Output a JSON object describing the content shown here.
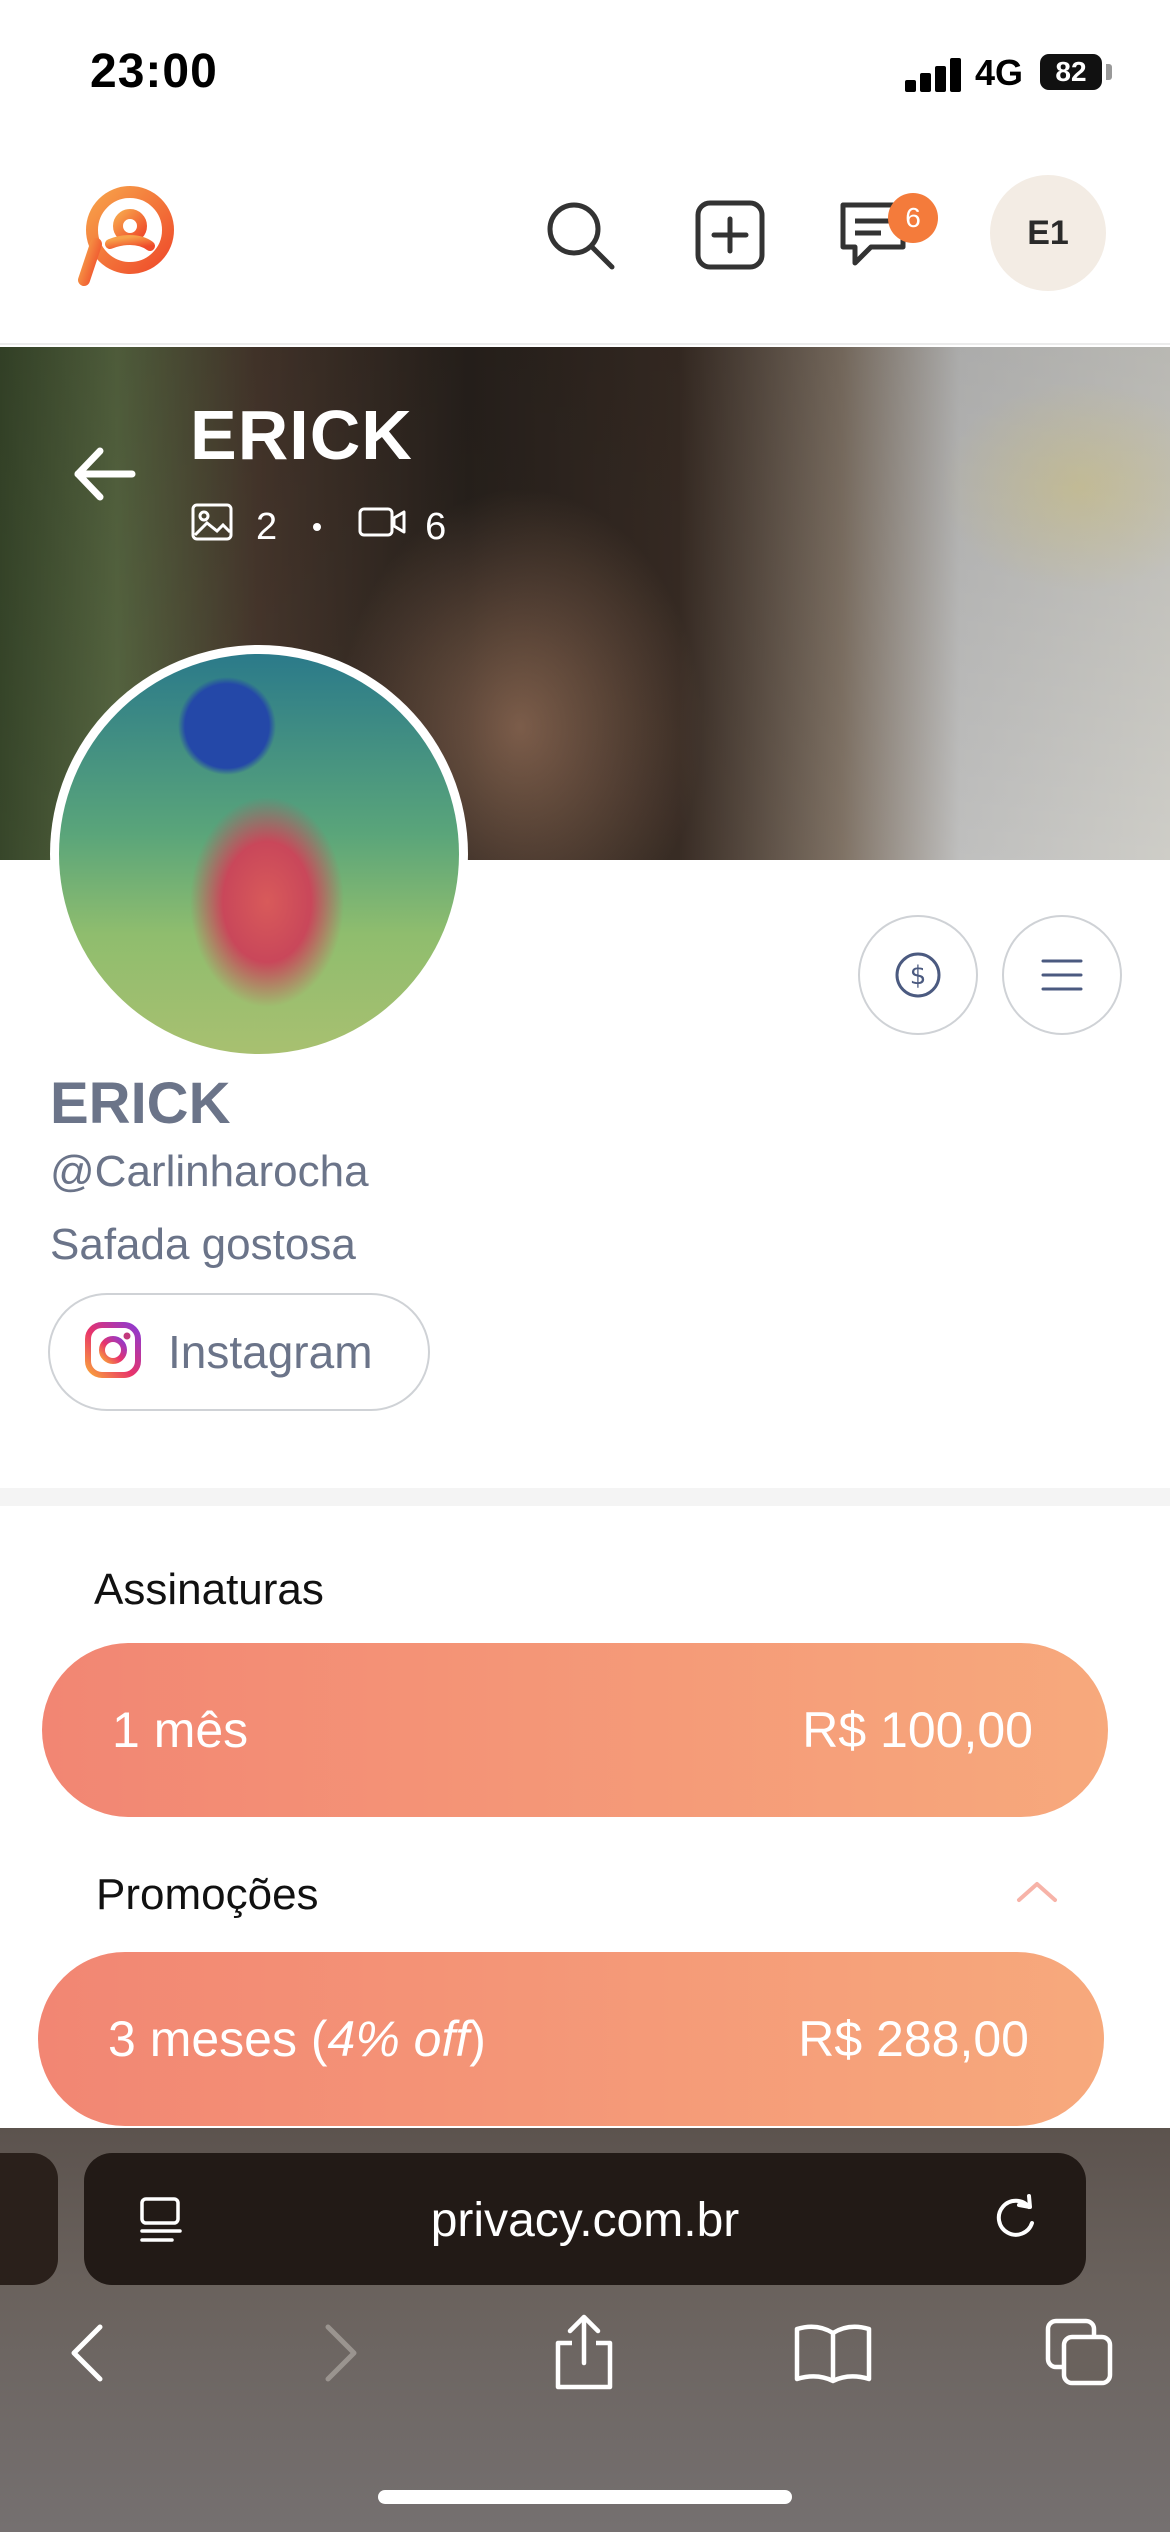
{
  "status_bar": {
    "time": "23:00",
    "network": "4G",
    "battery": "82"
  },
  "header": {
    "logo_icon": "privacy-logo-icon",
    "notification_count": "6",
    "avatar_initials": "E1",
    "accent_color": "#f47b3b"
  },
  "cover": {
    "title": "ERICK",
    "photo_count": "2",
    "video_count": "6"
  },
  "profile": {
    "name": "ERICK",
    "handle": "@Carlinharocha",
    "bio": "Safada gostosa",
    "instagram_label": "Instagram"
  },
  "subscriptions": {
    "title": "Assinaturas",
    "plan": {
      "label": "1 mês",
      "price": "R$ 100,00"
    }
  },
  "promotions": {
    "title": "Promoções",
    "plan": {
      "label_prefix": "3 meses (",
      "label_discount": "4% off",
      "label_suffix": ")",
      "price": "R$ 288,00"
    }
  },
  "browser": {
    "url": "privacy.com.br"
  }
}
